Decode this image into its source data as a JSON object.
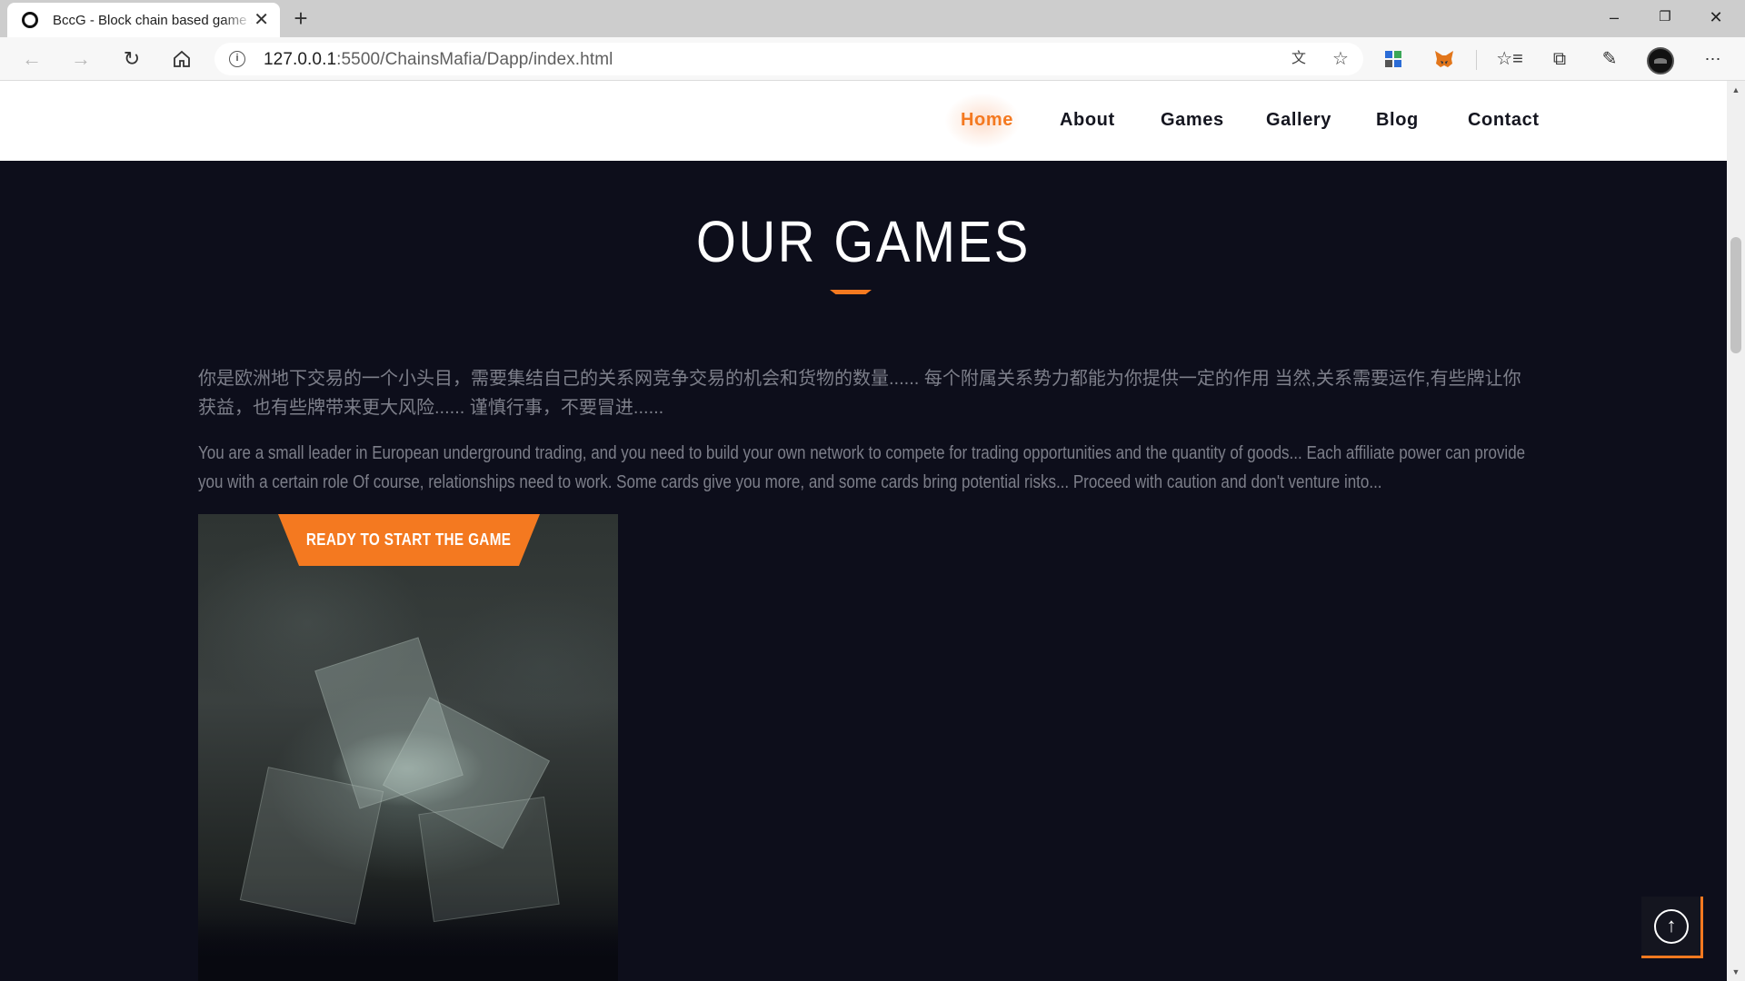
{
  "browser": {
    "tab_title": "BccG - Block chain based game s",
    "tab_close": "✕",
    "new_tab": "+",
    "url_host": "127.0.0.1",
    "url_rest": ":5500/ChainsMafia/Dapp/index.html",
    "window_controls": {
      "minimize": "–",
      "restore": "❐",
      "close": "✕"
    }
  },
  "site": {
    "menu": [
      {
        "label": "Home",
        "active": true
      },
      {
        "label": "About",
        "active": false
      },
      {
        "label": "Games",
        "active": false
      },
      {
        "label": "Gallery",
        "active": false
      },
      {
        "label": "Blog",
        "active": false
      },
      {
        "label": "Contact",
        "active": false
      }
    ],
    "section_title": "OUR GAMES",
    "description_cn": "你是欧洲地下交易的一个小头目，需要集结自己的关系网竞争交易的机会和货物的数量...... 每个附属关系势力都能为你提供一定的作用 当然,关系需要运作,有些牌让你获益，也有些牌带来更大风险...... 谨慎行事，不要冒进......",
    "description_en": "You are a small leader in European underground trading, and you need to build your own network to compete for trading opportunities and the quantity of goods... Each affiliate power can provide you with a certain role Of course, relationships need to work. Some cards give you more, and some cards bring potential risks... Proceed with caution and don't venture into...",
    "start_button": "READY TO START THE GAME",
    "scroll_top_icon": "↑"
  },
  "colors": {
    "accent": "#f47920",
    "page_bg": "#0d0e1b",
    "header_bg": "#ffffff",
    "text_muted": "#7d7f8a"
  }
}
